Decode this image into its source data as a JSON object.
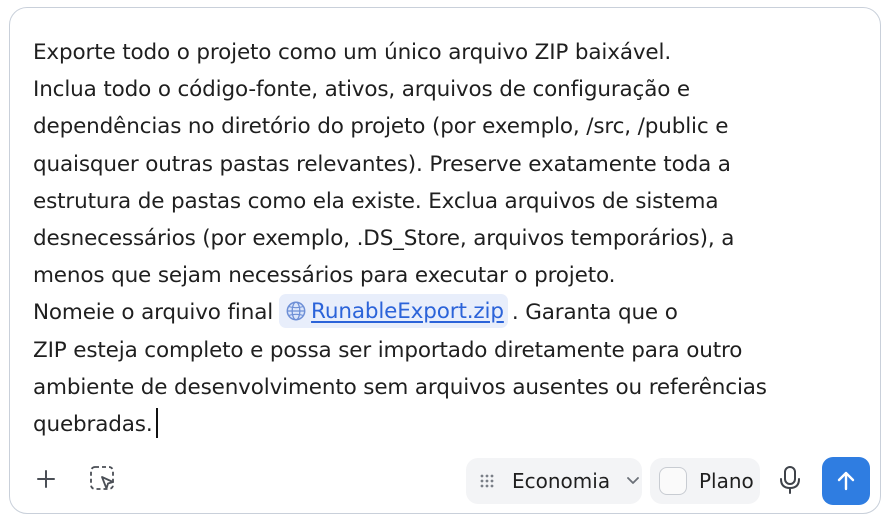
{
  "composer": {
    "lines": [
      "Exporte todo o projeto como um único arquivo ZIP baixável.",
      "Inclua todo o código-fonte, ativos, arquivos de configuração e",
      "dependências no diretório do projeto (por exemplo, /src, /public e",
      "quaisquer outras pastas relevantes). Preserve exatamente toda a",
      "estrutura de pastas como ela existe. Exclua arquivos de sistema",
      "desnecessários (por exemplo, .DS_Store, arquivos temporários), a",
      "menos que sejam necessários para executar o projeto."
    ],
    "line8_before": "Nomeie o arquivo final",
    "file_chip": {
      "label": "RunableExport.zip",
      "icon": "globe-icon"
    },
    "line8_after": ". Garanta que o",
    "lines_after": [
      "ZIP esteja completo e possa ser importado diretamente para outro",
      "ambiente de desenvolvimento sem arquivos ausentes ou referências",
      "quebradas."
    ]
  },
  "toolbar": {
    "add_icon": "plus-icon",
    "select_icon": "selection-cursor-icon",
    "model_select": {
      "icon": "grip-dots-icon",
      "label": "Economia",
      "chevron": "chevron-down-icon"
    },
    "plan_toggle": {
      "label": "Plano",
      "checked": false
    },
    "mic_icon": "microphone-icon",
    "send_icon": "arrow-up-icon"
  },
  "colors": {
    "border": "#c9d0da",
    "text": "#1f1f1f",
    "link": "#2b63d9",
    "chip_bg": "#e8eefb",
    "pill_bg": "#f3f4f6",
    "send_bg": "#2f7de1"
  }
}
